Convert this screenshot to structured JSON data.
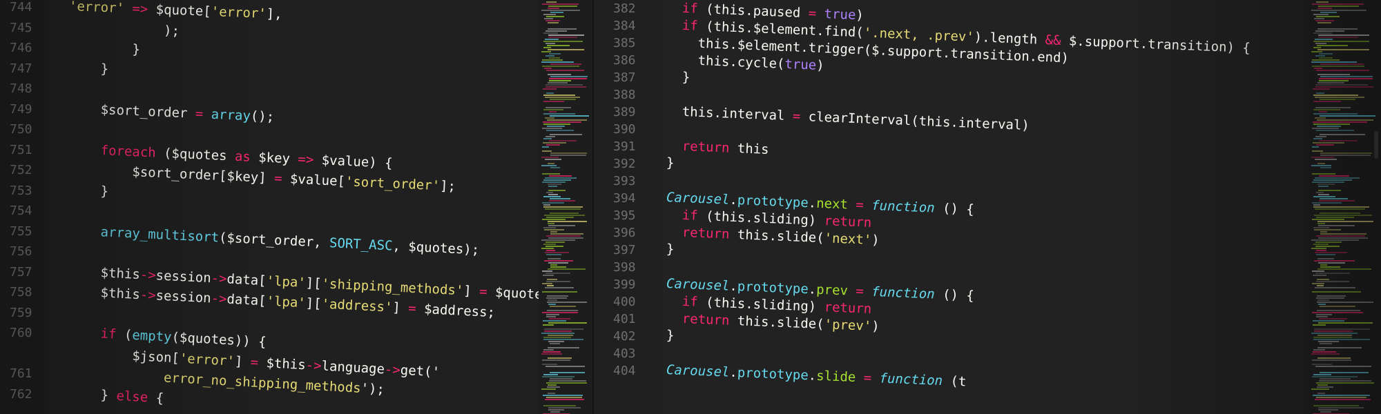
{
  "left_pane": {
    "lines": [
      {
        "n": "744",
        "tokens": [
          {
            "t": "",
            "c": "plain"
          },
          {
            "t": "'error'",
            "c": "str"
          },
          {
            "t": " => ",
            "c": "op"
          },
          {
            "t": "$quote[",
            "c": "var"
          },
          {
            "t": "'error'",
            "c": "str"
          },
          {
            "t": "],",
            "c": "punc"
          }
        ]
      },
      {
        "n": "745",
        "tokens": [
          {
            "t": "            );",
            "c": "punc"
          }
        ]
      },
      {
        "n": "746",
        "tokens": [
          {
            "t": "        }",
            "c": "punc"
          }
        ]
      },
      {
        "n": "747",
        "tokens": [
          {
            "t": "    }",
            "c": "punc"
          }
        ]
      },
      {
        "n": "748",
        "tokens": []
      },
      {
        "n": "749",
        "tokens": [
          {
            "t": "    $sort_order",
            "c": "var"
          },
          {
            "t": " = ",
            "c": "op"
          },
          {
            "t": "array",
            "c": "fn"
          },
          {
            "t": "();",
            "c": "punc"
          }
        ]
      },
      {
        "n": "750",
        "tokens": []
      },
      {
        "n": "751",
        "tokens": [
          {
            "t": "    foreach",
            "c": "kw"
          },
          {
            "t": " ($quotes ",
            "c": "var"
          },
          {
            "t": "as",
            "c": "kw"
          },
          {
            "t": " $key ",
            "c": "var"
          },
          {
            "t": "=>",
            "c": "op"
          },
          {
            "t": " $value) {",
            "c": "var"
          }
        ]
      },
      {
        "n": "752",
        "tokens": [
          {
            "t": "        $sort_order[$key]",
            "c": "var"
          },
          {
            "t": " = ",
            "c": "op"
          },
          {
            "t": "$value[",
            "c": "var"
          },
          {
            "t": "'sort_order'",
            "c": "str"
          },
          {
            "t": "];",
            "c": "punc"
          }
        ]
      },
      {
        "n": "753",
        "tokens": [
          {
            "t": "    }",
            "c": "punc"
          }
        ]
      },
      {
        "n": "754",
        "tokens": []
      },
      {
        "n": "755",
        "tokens": [
          {
            "t": "    array_multisort",
            "c": "fn"
          },
          {
            "t": "($sort_order, ",
            "c": "var"
          },
          {
            "t": "SORT_ASC",
            "c": "fn"
          },
          {
            "t": ", $quotes);",
            "c": "var"
          }
        ]
      },
      {
        "n": "756",
        "tokens": []
      },
      {
        "n": "757",
        "tokens": [
          {
            "t": "    $this",
            "c": "var"
          },
          {
            "t": "->",
            "c": "op"
          },
          {
            "t": "session",
            "c": "var"
          },
          {
            "t": "->",
            "c": "op"
          },
          {
            "t": "data[",
            "c": "var"
          },
          {
            "t": "'lpa'",
            "c": "str"
          },
          {
            "t": "][",
            "c": "punc"
          },
          {
            "t": "'shipping_methods'",
            "c": "str"
          },
          {
            "t": "] ",
            "c": "punc"
          },
          {
            "t": "=",
            "c": "op"
          },
          {
            "t": " $quotes;",
            "c": "var"
          }
        ]
      },
      {
        "n": "758",
        "tokens": [
          {
            "t": "    $this",
            "c": "var"
          },
          {
            "t": "->",
            "c": "op"
          },
          {
            "t": "session",
            "c": "var"
          },
          {
            "t": "->",
            "c": "op"
          },
          {
            "t": "data[",
            "c": "var"
          },
          {
            "t": "'lpa'",
            "c": "str"
          },
          {
            "t": "][",
            "c": "punc"
          },
          {
            "t": "'address'",
            "c": "str"
          },
          {
            "t": "] ",
            "c": "punc"
          },
          {
            "t": "=",
            "c": "op"
          },
          {
            "t": " $address;",
            "c": "var"
          }
        ]
      },
      {
        "n": "759",
        "tokens": []
      },
      {
        "n": "760",
        "tokens": [
          {
            "t": "    if",
            "c": "kw"
          },
          {
            "t": " (",
            "c": "punc"
          },
          {
            "t": "empty",
            "c": "fn"
          },
          {
            "t": "($quotes)) {",
            "c": "var"
          }
        ]
      },
      {
        "n": "",
        "tokens": [
          {
            "t": "        $json[",
            "c": "var"
          },
          {
            "t": "'error'",
            "c": "str"
          },
          {
            "t": "] ",
            "c": "punc"
          },
          {
            "t": "=",
            "c": "op"
          },
          {
            "t": " $this",
            "c": "var"
          },
          {
            "t": "->",
            "c": "op"
          },
          {
            "t": "language",
            "c": "var"
          },
          {
            "t": "->",
            "c": "op"
          },
          {
            "t": "get('",
            "c": "var"
          }
        ]
      },
      {
        "n": "761",
        "tokens": [
          {
            "t": "            error_no_shipping_methods",
            "c": "str"
          },
          {
            "t": "');",
            "c": "punc"
          }
        ]
      },
      {
        "n": "762",
        "tokens": [
          {
            "t": "    } ",
            "c": "punc"
          },
          {
            "t": "else",
            "c": "kw"
          },
          {
            "t": " {",
            "c": "punc"
          }
        ]
      }
    ]
  },
  "right_pane": {
    "lines": [
      {
        "n": "382",
        "tokens": [
          {
            "t": "  ",
            "c": "plain"
          },
          {
            "t": "if",
            "c": "kw"
          },
          {
            "t": " (this.paused ",
            "c": "plain"
          },
          {
            "t": "=",
            "c": "op"
          },
          {
            "t": " true",
            "c": "num"
          },
          {
            "t": ")",
            "c": "punc"
          }
        ]
      },
      {
        "n": "384",
        "tokens": [
          {
            "t": "  ",
            "c": "plain"
          },
          {
            "t": "if",
            "c": "kw"
          },
          {
            "t": " (this.$element.find(",
            "c": "plain"
          },
          {
            "t": "'.next, .prev'",
            "c": "str"
          },
          {
            "t": ").length ",
            "c": "plain"
          },
          {
            "t": "&&",
            "c": "op"
          },
          {
            "t": " $.support.transition) {",
            "c": "plain"
          }
        ]
      },
      {
        "n": "385",
        "tokens": [
          {
            "t": "    this.$element.trigger($.support.transition.end)",
            "c": "plain"
          }
        ]
      },
      {
        "n": "386",
        "tokens": [
          {
            "t": "    this.cycle(",
            "c": "plain"
          },
          {
            "t": "true",
            "c": "num"
          },
          {
            "t": ")",
            "c": "punc"
          }
        ]
      },
      {
        "n": "387",
        "tokens": [
          {
            "t": "  }",
            "c": "punc"
          }
        ]
      },
      {
        "n": "388",
        "tokens": []
      },
      {
        "n": "389",
        "tokens": [
          {
            "t": "  this.interval ",
            "c": "plain"
          },
          {
            "t": "=",
            "c": "op"
          },
          {
            "t": " clearInterval(this.interval)",
            "c": "plain"
          }
        ]
      },
      {
        "n": "390",
        "tokens": []
      },
      {
        "n": "391",
        "tokens": [
          {
            "t": "  ",
            "c": "plain"
          },
          {
            "t": "return",
            "c": "kw"
          },
          {
            "t": " this",
            "c": "plain"
          }
        ]
      },
      {
        "n": "392",
        "tokens": [
          {
            "t": "}",
            "c": "punc"
          }
        ]
      },
      {
        "n": "393",
        "tokens": []
      },
      {
        "n": "394",
        "tokens": [
          {
            "t": "Carousel",
            "c": "type"
          },
          {
            "t": ".",
            "c": "punc"
          },
          {
            "t": "prototype",
            "c": "fn"
          },
          {
            "t": ".",
            "c": "punc"
          },
          {
            "t": "next",
            "c": "prop"
          },
          {
            "t": " = ",
            "c": "op"
          },
          {
            "t": "function",
            "c": "type"
          },
          {
            "t": " () {",
            "c": "punc"
          }
        ]
      },
      {
        "n": "395",
        "tokens": [
          {
            "t": "  ",
            "c": "plain"
          },
          {
            "t": "if",
            "c": "kw"
          },
          {
            "t": " (this.sliding) ",
            "c": "plain"
          },
          {
            "t": "return",
            "c": "kw"
          }
        ]
      },
      {
        "n": "396",
        "tokens": [
          {
            "t": "  ",
            "c": "plain"
          },
          {
            "t": "return",
            "c": "kw"
          },
          {
            "t": " this.slide(",
            "c": "plain"
          },
          {
            "t": "'next'",
            "c": "str"
          },
          {
            "t": ")",
            "c": "punc"
          }
        ]
      },
      {
        "n": "397",
        "tokens": [
          {
            "t": "}",
            "c": "punc"
          }
        ]
      },
      {
        "n": "398",
        "tokens": []
      },
      {
        "n": "399",
        "tokens": [
          {
            "t": "Carousel",
            "c": "type"
          },
          {
            "t": ".",
            "c": "punc"
          },
          {
            "t": "prototype",
            "c": "fn"
          },
          {
            "t": ".",
            "c": "punc"
          },
          {
            "t": "prev",
            "c": "prop"
          },
          {
            "t": " = ",
            "c": "op"
          },
          {
            "t": "function",
            "c": "type"
          },
          {
            "t": " () {",
            "c": "punc"
          }
        ]
      },
      {
        "n": "400",
        "tokens": [
          {
            "t": "  ",
            "c": "plain"
          },
          {
            "t": "if",
            "c": "kw"
          },
          {
            "t": " (this.sliding) ",
            "c": "plain"
          },
          {
            "t": "return",
            "c": "kw"
          }
        ]
      },
      {
        "n": "401",
        "tokens": [
          {
            "t": "  ",
            "c": "plain"
          },
          {
            "t": "return",
            "c": "kw"
          },
          {
            "t": " this.slide(",
            "c": "plain"
          },
          {
            "t": "'prev'",
            "c": "str"
          },
          {
            "t": ")",
            "c": "punc"
          }
        ]
      },
      {
        "n": "402",
        "tokens": [
          {
            "t": "}",
            "c": "punc"
          }
        ]
      },
      {
        "n": "403",
        "tokens": []
      },
      {
        "n": "404",
        "tokens": [
          {
            "t": "Carousel",
            "c": "type"
          },
          {
            "t": ".",
            "c": "punc"
          },
          {
            "t": "prototype",
            "c": "fn"
          },
          {
            "t": ".",
            "c": "punc"
          },
          {
            "t": "slide",
            "c": "prop"
          },
          {
            "t": " = ",
            "c": "op"
          },
          {
            "t": "function",
            "c": "type"
          },
          {
            "t": " (t",
            "c": "punc"
          }
        ]
      }
    ]
  },
  "theme": {
    "background": "#1c1c1c",
    "keyword": "#f92672",
    "string": "#e6db74",
    "function": "#66d9ef",
    "number": "#ae81ff",
    "property": "#a6e22e",
    "line_number": "#6f6f6f"
  }
}
